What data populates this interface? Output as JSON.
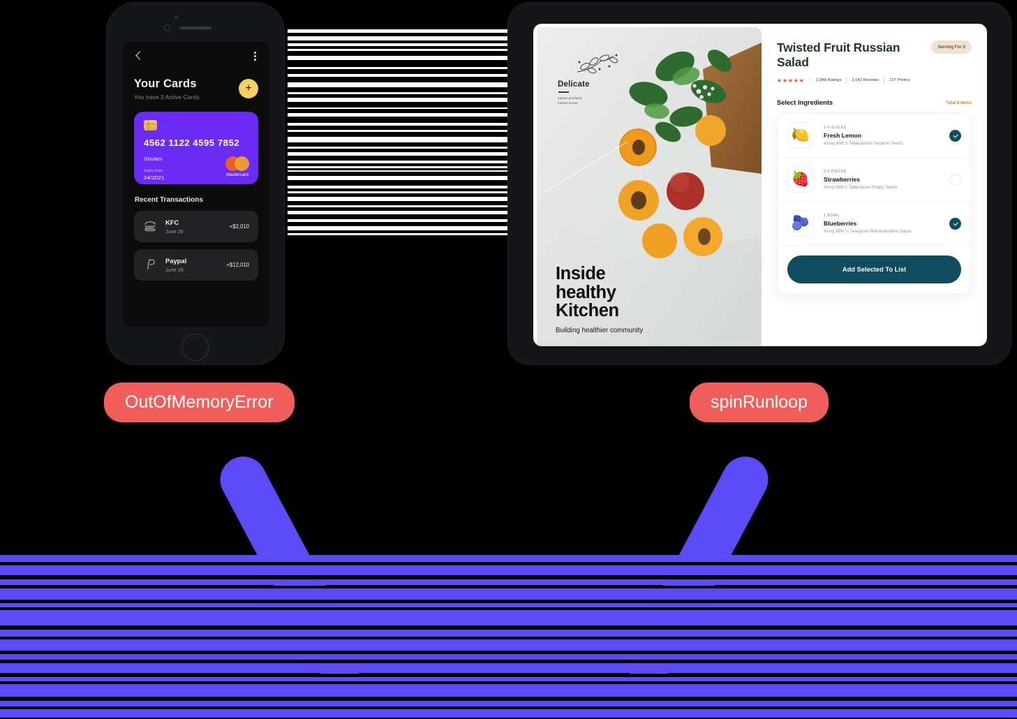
{
  "theme": {
    "background": "#000000",
    "label_bg": "#f15f5c",
    "accent_purple": "#5d4bf7",
    "card_purple": "#6a2bf5",
    "teal": "#0e4c5e",
    "gold": "#f6cf63",
    "orange": "#c98429"
  },
  "phone": {
    "screen": {
      "back_icon": "chevron-left-icon",
      "menu_icon": "more-vertical-icon",
      "title": "Your Cards",
      "subtitle": "You have 3 Active Cards",
      "add_label": "+",
      "card": {
        "chip_icon": "sim-chip-icon",
        "number": "4562 1122 4595 7852",
        "holder": "Ghulam",
        "expiry_label": "Expiry Date",
        "expiry_value": "24/2021",
        "brand": "Mastercard"
      },
      "transactions_title": "Recent Transactions",
      "transactions": [
        {
          "icon": "burger-icon",
          "name": "KFC",
          "date": "June 26",
          "amount": "+$2,010"
        },
        {
          "icon": "paypal-icon",
          "name": "Paypal",
          "date": "June 28",
          "amount": "+$12,010"
        }
      ]
    }
  },
  "tablet": {
    "hero": {
      "logo_icon": "leaf-branch-icon",
      "brand": "Delicate",
      "tagline_line1": "nature products",
      "tagline_line2": "herbal house",
      "headline_line1": "Inside",
      "headline_line2": "healthy",
      "headline_line3": "Kitchen",
      "subline": "Building healthier community"
    },
    "panel": {
      "title": "Twisted Fruit Russian Salad",
      "serving_badge": "Serving For 2",
      "stars": "★★★★★",
      "rating_dash": "-",
      "ratings": "2,948 Ratings",
      "reviews": "2,042 Reviews",
      "photos": "127 Photos",
      "section_title": "Select Ingredients",
      "total_items": "Total 8 Items",
      "ingredients": [
        {
          "icon": "lemon-icon",
          "qty": "3-4 SLICES",
          "name": "Fresh Lemon",
          "desc": "Along With 2 Tablespoons Sesame Seeds",
          "selected": true
        },
        {
          "icon": "strawberry-icon",
          "qty": "2-5 PIECES",
          "name": "Strawberries",
          "desc": "Along With 1 Tablespoon Poppy Seeds",
          "selected": false
        },
        {
          "icon": "blueberry-icon",
          "qty": "1 BOWL",
          "name": "Blueberries",
          "desc": "Along With ¼ Teaspoon Worcestershire Sauce",
          "selected": true
        }
      ],
      "cta_label": "Add Selected To List"
    }
  },
  "labels": {
    "phone_label": "OutOfMemoryError",
    "tablet_label": "spinRunloop"
  }
}
